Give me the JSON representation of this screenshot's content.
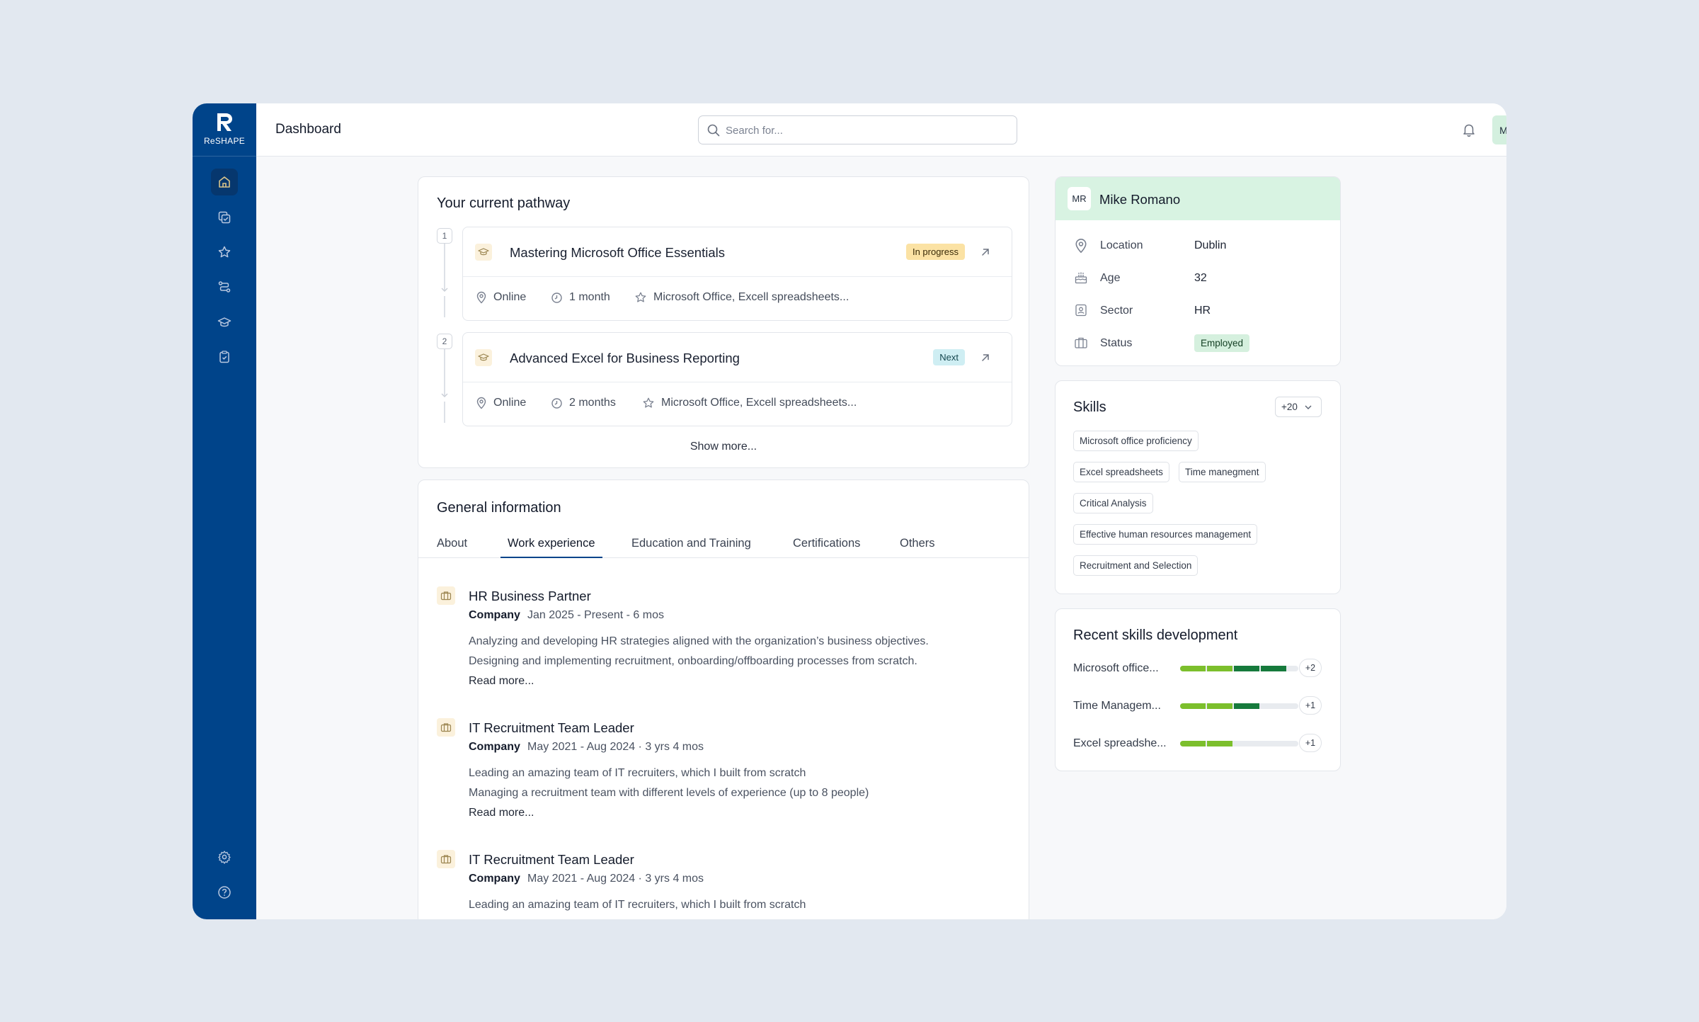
{
  "app": {
    "logo_text": "ReSHAPE",
    "page_title": "Dashboard"
  },
  "search": {
    "placeholder": "Search for..."
  },
  "user": {
    "initials": "MR"
  },
  "sidebar": {
    "items": [
      {
        "icon": "home-icon",
        "active": true
      },
      {
        "icon": "tasks-icon"
      },
      {
        "icon": "star-icon"
      },
      {
        "icon": "pathway-icon"
      },
      {
        "icon": "graduation-cap-icon"
      },
      {
        "icon": "clipboard-icon"
      }
    ],
    "bottom": [
      {
        "icon": "gear-icon"
      },
      {
        "icon": "help-icon"
      }
    ]
  },
  "pathway": {
    "title": "Your current pathway",
    "steps": [
      {
        "number": "1",
        "title": "Mastering Microsoft Office Essentials",
        "status": "In progress",
        "mode": "Online",
        "duration": "1 month",
        "skills": "Microsoft Office, Excell spreadsheets..."
      },
      {
        "number": "2",
        "title": "Advanced Excel for Business Reporting",
        "status": "Next",
        "mode": "Online",
        "duration": "2 months",
        "skills": "Microsoft Office, Excell spreadsheets..."
      }
    ],
    "show_more": "Show more..."
  },
  "general": {
    "title": "General information",
    "tabs": [
      "About",
      "Work experience",
      "Education and Training",
      "Certifications",
      "Others"
    ],
    "active_tab": "Work experience",
    "jobs": [
      {
        "title": "HR Business Partner",
        "company": "Company",
        "dates": "Jan 2025 - Present - 6 mos",
        "lines": [
          "Analyzing and developing HR strategies aligned with the organization’s business objectives.",
          "Designing and implementing recruitment, onboarding/offboarding processes from scratch."
        ],
        "read_more": "Read more..."
      },
      {
        "title": "IT Recruitment Team Leader",
        "company": "Company",
        "dates": "May 2021 - Aug 2024 · 3 yrs 4 mos",
        "lines": [
          "Leading an amazing team of IT recruiters, which I built from scratch",
          "Managing a recruitment team with different levels of experience (up to 8 people)"
        ],
        "read_more": "Read more..."
      },
      {
        "title": "IT Recruitment Team Leader",
        "company": "Company",
        "dates": "May 2021 - Aug 2024 · 3 yrs 4 mos",
        "lines": [
          "Leading an amazing team of IT recruiters, which I built from scratch"
        ]
      }
    ]
  },
  "profile": {
    "initials": "MR",
    "name": "Mike Romano",
    "rows": [
      {
        "label": "Location",
        "value": "Dublin",
        "icon": "location-pin-icon"
      },
      {
        "label": "Age",
        "value": "32",
        "icon": "cake-icon"
      },
      {
        "label": "Sector",
        "value": "HR",
        "icon": "badge-id-icon"
      },
      {
        "label": "Status",
        "value": "Employed",
        "icon": "briefcase-icon"
      }
    ]
  },
  "skills": {
    "title": "Skills",
    "more_count": "+20",
    "chips": [
      "Microsoft office proficiency",
      "Excel spreadsheets",
      "Time manegment",
      "Critical Analysis",
      "Effective human resources management",
      "Recruitment and Selection"
    ]
  },
  "recent": {
    "title": "Recent skills development",
    "rows": [
      {
        "name": "Microsoft office...",
        "delta": "+2",
        "levels": 4
      },
      {
        "name": "Time Managem...",
        "delta": "+1",
        "levels": 3
      },
      {
        "name": "Excel spreadshe...",
        "delta": "+1",
        "levels": 2
      }
    ],
    "colors": {
      "light": "#7cbf2c",
      "dark": "#167a3c",
      "track": "#e8ebef"
    }
  }
}
